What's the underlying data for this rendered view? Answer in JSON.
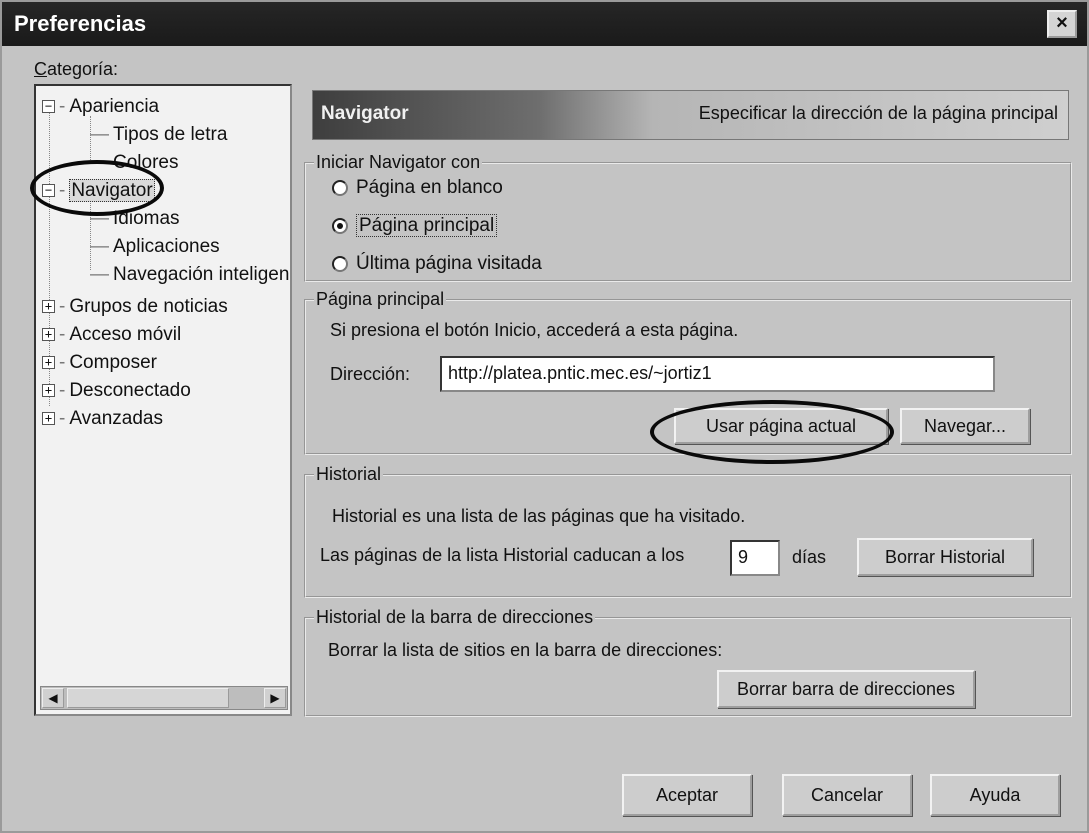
{
  "window": {
    "title": "Preferencias"
  },
  "icons": {
    "close": "close-icon",
    "expand": "plus-box-icon",
    "collapse": "minus-box-icon"
  },
  "category": {
    "label_u": "C",
    "label_rest": "ategoría:",
    "tree": [
      {
        "label": "Apariencia",
        "level": 0,
        "state": "collapsed-minus"
      },
      {
        "label": "Tipos de letra",
        "level": 1
      },
      {
        "label": "Colores",
        "level": 1
      },
      {
        "label": "Navigator",
        "level": 0,
        "state": "collapsed-minus",
        "selected": true
      },
      {
        "label": "Idiomas",
        "level": 1
      },
      {
        "label": "Aplicaciones",
        "level": 1
      },
      {
        "label": "Navegación inteligen",
        "level": 1
      },
      {
        "label": "Grupos de noticias",
        "level": 0,
        "state": "plus"
      },
      {
        "label": "Acceso móvil",
        "level": 0,
        "state": "plus"
      },
      {
        "label": "Composer",
        "level": 0,
        "state": "plus"
      },
      {
        "label": "Desconectado",
        "level": 0,
        "state": "plus"
      },
      {
        "label": "Avanzadas",
        "level": 0,
        "state": "plus"
      }
    ]
  },
  "panel": {
    "title": "Navigator",
    "description": "Especificar la dirección de la página principal"
  },
  "start_group": {
    "legend": "Iniciar Navigator con",
    "options": [
      {
        "label": "Página en blanco",
        "checked": false
      },
      {
        "label": "Página principal",
        "checked": true
      },
      {
        "label": "Última página visitada",
        "checked": false
      }
    ]
  },
  "home_group": {
    "legend": "Página principal",
    "hint": "Si presiona el botón Inicio, accederá a esta página.",
    "address_label": "Dirección:",
    "address_value": "http://platea.pntic.mec.es/~jortiz1",
    "use_current_button": "Usar página actual",
    "browse_button": "Navegar..."
  },
  "history_group": {
    "legend": "Historial",
    "desc": "Historial es una lista de las páginas que ha visitado.",
    "expire_label": "Las páginas de la lista Historial caducan a los",
    "days_value": "9",
    "days_label": "días",
    "clear_button": "Borrar Historial"
  },
  "urlbar_group": {
    "legend": "Historial de la barra de direcciones",
    "desc": "Borrar la lista de sitios en la barra de direcciones:",
    "clear_button": "Borrar barra de direcciones"
  },
  "footer": {
    "ok": "Aceptar",
    "cancel": "Cancelar",
    "help": "Ayuda"
  }
}
